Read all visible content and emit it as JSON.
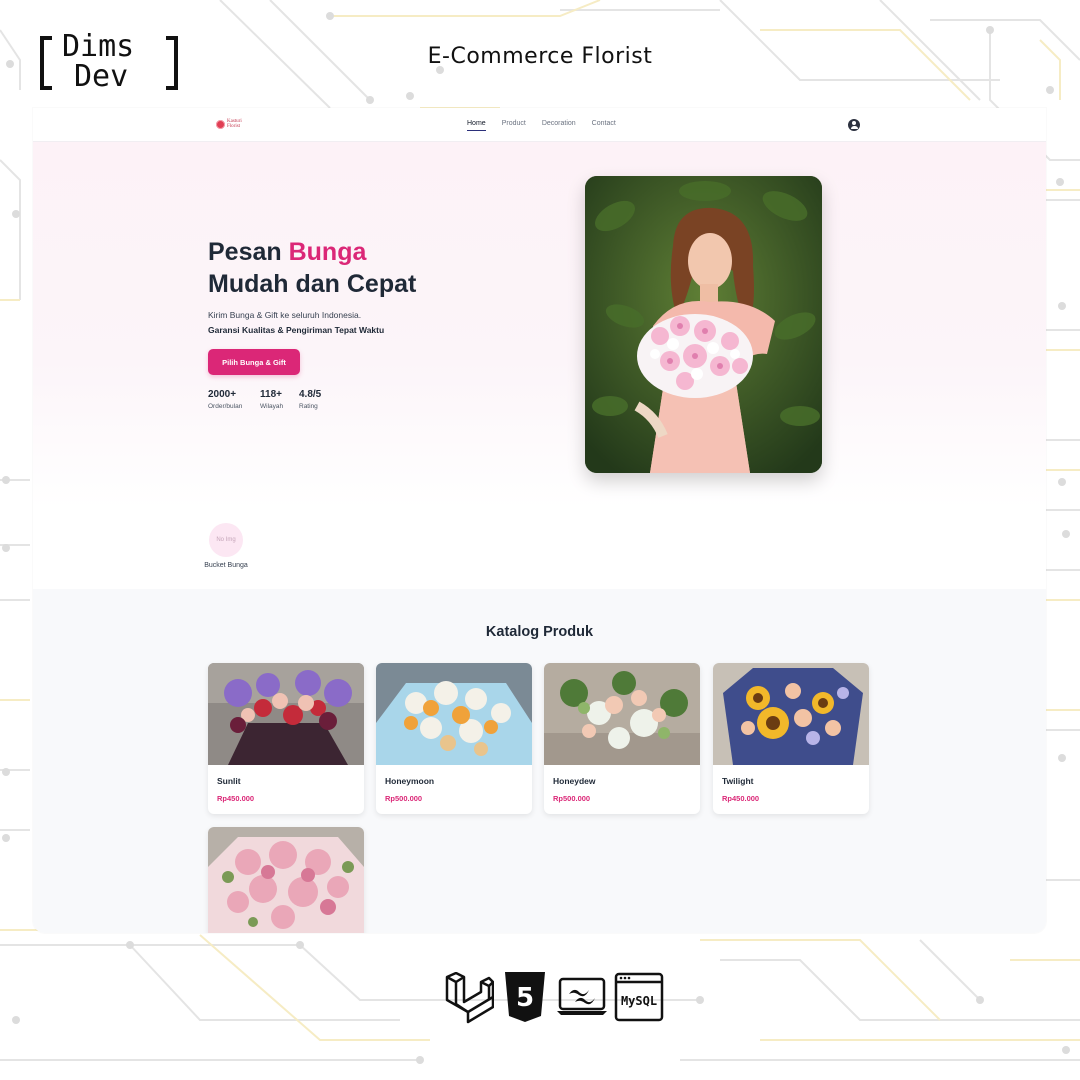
{
  "branding": {
    "logo_line1": "Dims",
    "logo_line2": "Dev",
    "page_title": "E-Commerce Florist"
  },
  "nav": {
    "logo_text_line1": "Kasturi",
    "logo_text_line2": "Florist",
    "links": [
      {
        "label": "Home",
        "active": true
      },
      {
        "label": "Product",
        "active": false
      },
      {
        "label": "Decoration",
        "active": false
      },
      {
        "label": "Contact",
        "active": false
      }
    ],
    "user_icon": "user-circle-icon"
  },
  "hero": {
    "title_part1": "Pesan ",
    "title_accent": "Bunga",
    "title_line2": "Mudah dan Cepat",
    "subtitle": "Kirim Bunga & Gift ke seluruh Indonesia.",
    "subtitle_bold": "Garansi Kualitas & Pengiriman Tepat Waktu",
    "cta_label": "Pilih Bunga & Gift",
    "stats": [
      {
        "value": "2000+",
        "label": "Order/bulan"
      },
      {
        "value": "118+",
        "label": "Wilayah"
      },
      {
        "value": "4.8/5",
        "label": "Rating"
      }
    ]
  },
  "categories": [
    {
      "placeholder": "No Img",
      "label": "Bucket Bunga"
    }
  ],
  "catalog": {
    "title": "Katalog Produk",
    "products": [
      {
        "name": "Sunlit",
        "price": "Rp450.000"
      },
      {
        "name": "Honeymoon",
        "price": "Rp500.000"
      },
      {
        "name": "Honeydew",
        "price": "Rp500.000"
      },
      {
        "name": "Twilight",
        "price": "Rp450.000"
      }
    ]
  },
  "tech_stack": [
    "laravel-icon",
    "html5-icon",
    "tailwind-icon",
    "mysql-icon"
  ],
  "tech_labels": {
    "html5": "5",
    "mysql": "MySQL"
  },
  "colors": {
    "accent": "#db2777",
    "text_dark": "#1f2937",
    "hero_bg": "#fdf2f7",
    "catalog_bg": "#f8f9fb"
  }
}
